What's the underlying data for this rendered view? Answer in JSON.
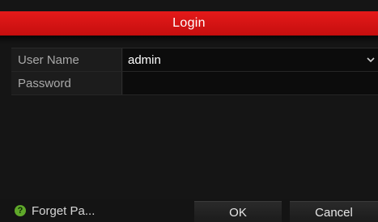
{
  "dialog": {
    "title": "Login",
    "accent_color": "#d81414"
  },
  "form": {
    "username_label": "User Name",
    "username_value": "admin",
    "password_label": "Password",
    "password_value": ""
  },
  "footer": {
    "forget_password_label": "Forget Pa...",
    "help_icon_glyph": "?",
    "help_icon_color": "#5fa82a",
    "ok_label": "OK",
    "cancel_label": "Cancel"
  }
}
